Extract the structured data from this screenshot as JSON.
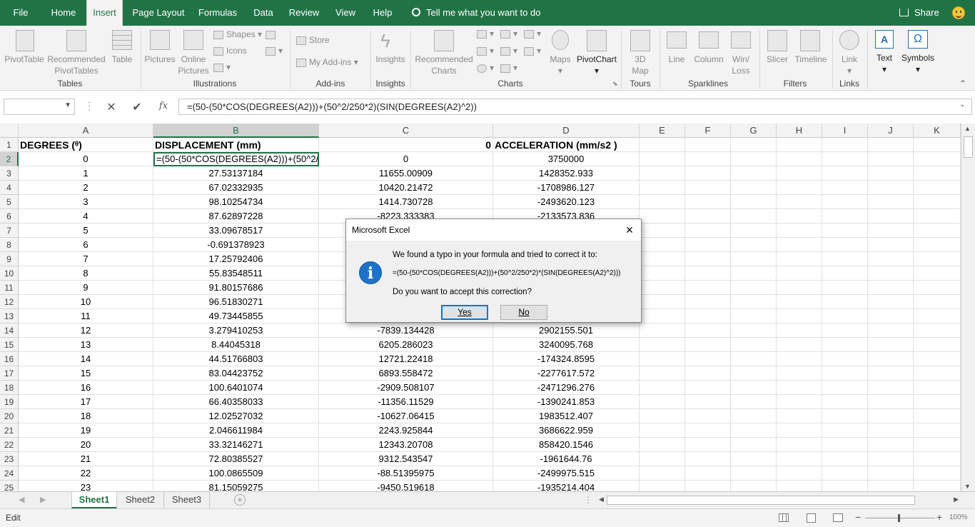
{
  "menu": {
    "tabs": [
      "File",
      "Home",
      "Insert",
      "Page Layout",
      "Formulas",
      "Data",
      "Review",
      "View",
      "Help"
    ],
    "active_tab": "Insert",
    "tell_me": "Tell me what you want to do",
    "share": "Share"
  },
  "ribbon": {
    "groups": {
      "tables": "Tables",
      "illustrations": "Illustrations",
      "addins": "Add-ins",
      "insights": "Insights",
      "charts": "Charts",
      "tours": "Tours",
      "sparklines": "Sparklines",
      "filters": "Filters",
      "links": "Links"
    },
    "buttons": {
      "pivottable": "PivotTable",
      "recommended_pivottables_1": "Recommended",
      "recommended_pivottables_2": "PivotTables",
      "table": "Table",
      "pictures": "Pictures",
      "online_pictures_1": "Online",
      "online_pictures_2": "Pictures",
      "shapes": "Shapes",
      "icons": "Icons",
      "store": "Store",
      "my_addins": "My Add-ins",
      "insights": "Insights",
      "recommended_charts_1": "Recommended",
      "recommended_charts_2": "Charts",
      "maps": "Maps",
      "pivotchart": "PivotChart",
      "map3d_1": "3D",
      "map3d_2": "Map",
      "line": "Line",
      "column": "Column",
      "winloss_1": "Win/",
      "winloss_2": "Loss",
      "slicer": "Slicer",
      "timeline": "Timeline",
      "link": "Link",
      "text": "Text",
      "symbols": "Symbols"
    }
  },
  "formula_bar": {
    "name_box": "",
    "cancel": "✕",
    "enter": "✔",
    "fx": "fx",
    "formula": "=(50-(50*COS(DEGREES(A2)))+(50^2/250*2)(SIN(DEGREES(A2)^2))"
  },
  "grid": {
    "columns": [
      "A",
      "B",
      "C",
      "D",
      "E",
      "F",
      "G",
      "H",
      "I",
      "J",
      "K"
    ],
    "selected_column": "B",
    "selected_row": 2,
    "rows": [
      {
        "n": "1",
        "a": "DEGREES (ᶿ)",
        "b": "DISPLACEMENT (mm)",
        "c": "0",
        "d": "ACCELERATION (mm/s2 )"
      },
      {
        "n": "2",
        "a": "0",
        "b": "=(50-(50*COS(DEGREES(A2)))+(50^2/",
        "c": "0",
        "d": "3750000"
      },
      {
        "n": "3",
        "a": "1",
        "b": "27.53137184",
        "c": "11655.00909",
        "d": "1428352.933"
      },
      {
        "n": "4",
        "a": "2",
        "b": "67.02332935",
        "c": "10420.21472",
        "d": "-1708986.127"
      },
      {
        "n": "5",
        "a": "3",
        "b": "98.10254734",
        "c": "1414.730728",
        "d": "-2493620.123"
      },
      {
        "n": "6",
        "a": "4",
        "b": "87.62897228",
        "c": "-8223.333383",
        "d": "-2133573.836"
      },
      {
        "n": "7",
        "a": "5",
        "b": "33.09678517",
        "c": "",
        "d": ""
      },
      {
        "n": "8",
        "a": "6",
        "b": "-0.691378923",
        "c": "",
        "d": ""
      },
      {
        "n": "9",
        "a": "7",
        "b": "17.25792406",
        "c": "",
        "d": ""
      },
      {
        "n": "10",
        "a": "8",
        "b": "55.83548511",
        "c": "",
        "d": ""
      },
      {
        "n": "11",
        "a": "9",
        "b": "91.80157686",
        "c": "",
        "d": ""
      },
      {
        "n": "12",
        "a": "10",
        "b": "96.51830271",
        "c": "",
        "d": ""
      },
      {
        "n": "13",
        "a": "11",
        "b": "49.73445855",
        "c": "",
        "d": ""
      },
      {
        "n": "14",
        "a": "12",
        "b": "3.279410253",
        "c": "-7839.134428",
        "d": "2902155.501"
      },
      {
        "n": "15",
        "a": "13",
        "b": "8.44045318",
        "c": "6205.286023",
        "d": "3240095.768"
      },
      {
        "n": "16",
        "a": "14",
        "b": "44.51766803",
        "c": "12721.22418",
        "d": "-174324.8595"
      },
      {
        "n": "17",
        "a": "15",
        "b": "83.04423752",
        "c": "6893.558472",
        "d": "-2277617.572"
      },
      {
        "n": "18",
        "a": "16",
        "b": "100.6401074",
        "c": "-2909.508107",
        "d": "-2471296.276"
      },
      {
        "n": "19",
        "a": "17",
        "b": "66.40358033",
        "c": "-11356.11529",
        "d": "-1390241.853"
      },
      {
        "n": "20",
        "a": "18",
        "b": "12.02527032",
        "c": "-10627.06415",
        "d": "1983512.407"
      },
      {
        "n": "21",
        "a": "19",
        "b": "2.046611984",
        "c": "2243.925844",
        "d": "3686622.959"
      },
      {
        "n": "22",
        "a": "20",
        "b": "33.32146271",
        "c": "12343.20708",
        "d": "858420.1546"
      },
      {
        "n": "23",
        "a": "21",
        "b": "72.80385527",
        "c": "9312.543547",
        "d": "-1961644.76"
      },
      {
        "n": "24",
        "a": "22",
        "b": "100.0865509",
        "c": "-88.51395975",
        "d": "-2499975.515"
      },
      {
        "n": "25",
        "a": "23",
        "b": "81.15059275",
        "c": "-9450.519618",
        "d": "-1935214.404"
      }
    ]
  },
  "sheets": {
    "tabs": [
      "Sheet1",
      "Sheet2",
      "Sheet3"
    ],
    "active": "Sheet1",
    "add": "+"
  },
  "status": {
    "mode": "Edit",
    "zoom": "100%"
  },
  "dialog": {
    "title": "Microsoft Excel",
    "message": "We found a typo in your formula and tried to correct it to:",
    "correction": "=(50-(50*COS(DEGREES(A2)))+(50^2/250*2)*(SIN(DEGREES(A2)^2)))",
    "question": "Do you want to accept this correction?",
    "yes": "Yes",
    "no": "No",
    "info_icon": "i"
  },
  "colors": {
    "brand": "#217346",
    "accent_blue": "#0078d7"
  }
}
